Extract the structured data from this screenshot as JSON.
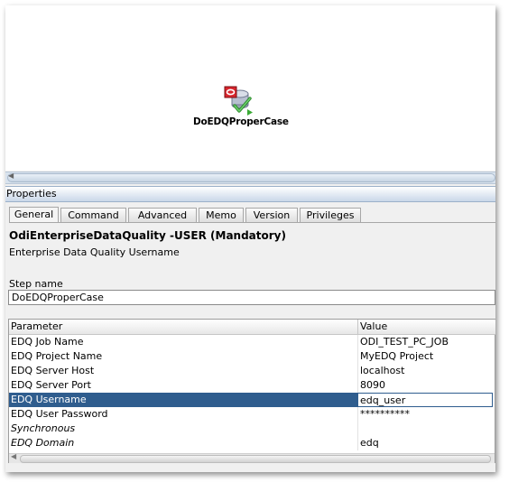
{
  "canvas": {
    "step_node": {
      "label": "DoEDQProperCase",
      "icon": "edq-step-icon"
    }
  },
  "properties": {
    "title": "Properties",
    "tabs": [
      {
        "label": "General",
        "active": true
      },
      {
        "label": "Command",
        "active": false
      },
      {
        "label": "Advanced",
        "active": false
      },
      {
        "label": "Memo",
        "active": false
      },
      {
        "label": "Version",
        "active": false
      },
      {
        "label": "Privileges",
        "active": false
      }
    ],
    "option_title": "OdiEnterpriseDataQuality -USER (Mandatory)",
    "option_description": "Enterprise Data Quality Username",
    "step_name_label": "Step name",
    "step_name_value": "DoEDQProperCase",
    "table": {
      "headers": [
        "Parameter",
        "Value"
      ],
      "rows": [
        {
          "param": "EDQ Job Name",
          "value": "ODI_TEST_PC_JOB"
        },
        {
          "param": "EDQ Project Name",
          "value": "MyEDQ Project"
        },
        {
          "param": "EDQ Server Host",
          "value": "localhost"
        },
        {
          "param": "EDQ Server Port",
          "value": "8090"
        },
        {
          "param": "EDQ Username",
          "value": "edq_user",
          "selected": true
        },
        {
          "param": "EDQ User Password",
          "value": "**********"
        },
        {
          "param": "Synchronous",
          "value": "",
          "italic": true
        },
        {
          "param": "EDQ Domain",
          "value": "edq",
          "italic": true
        }
      ]
    }
  },
  "colors": {
    "selection": "#2f5d8e",
    "header_band": "#c9d7e9"
  }
}
